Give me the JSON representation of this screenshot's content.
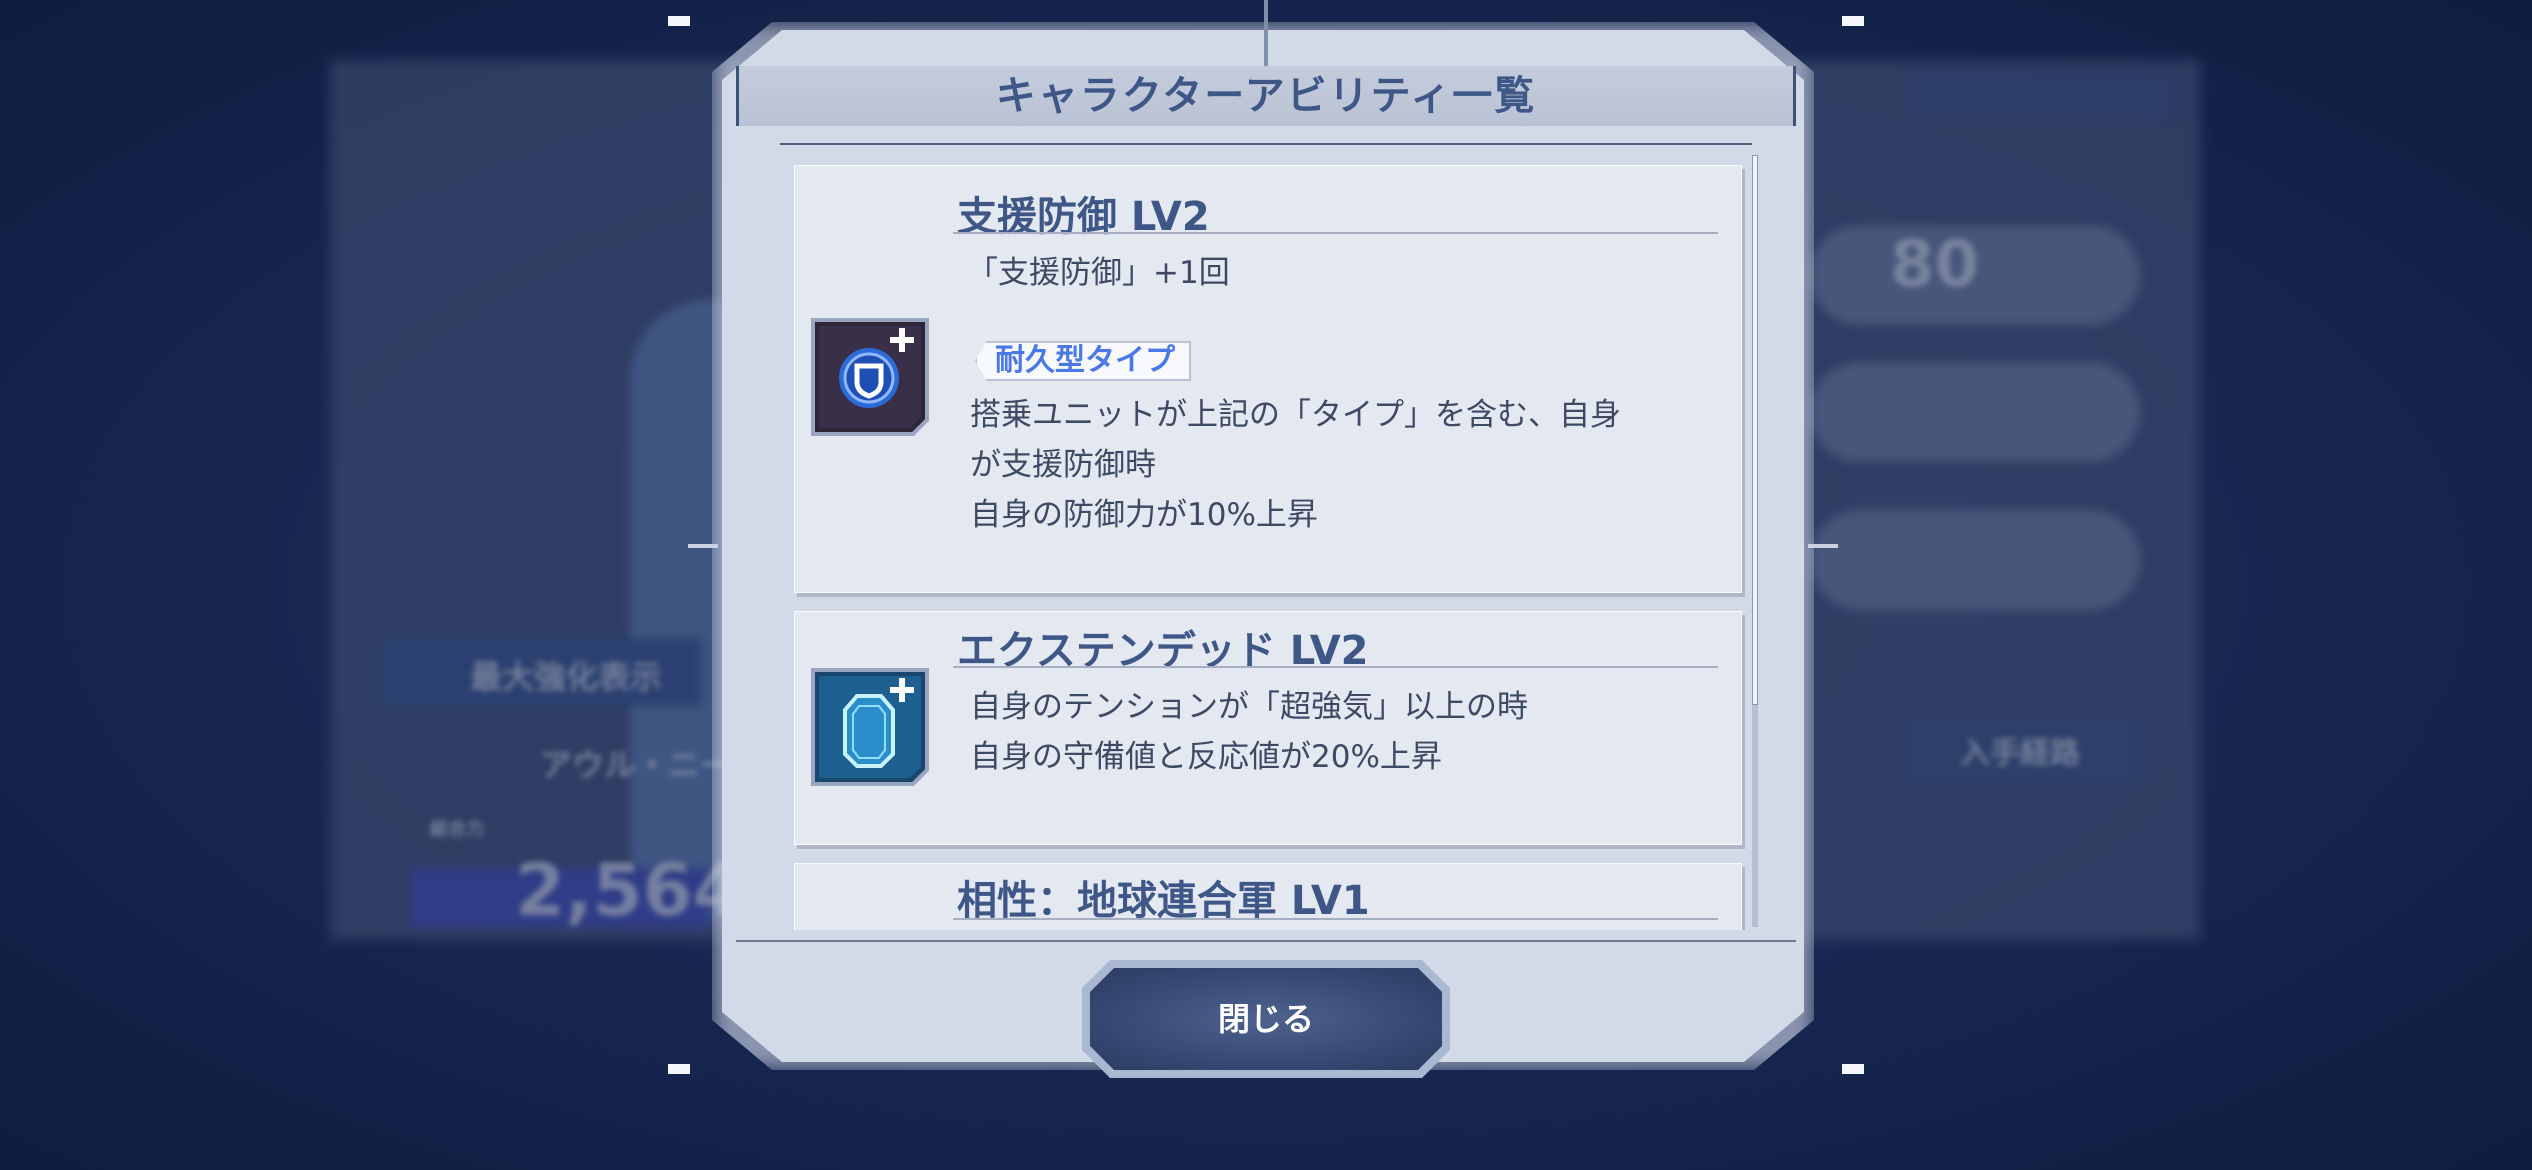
{
  "modal": {
    "title": "キャラクターアビリティ一覧",
    "close_label": "閉じる"
  },
  "abilities": [
    {
      "title": "支援防御 LV2",
      "line1": "「支援防御」+1回",
      "type_tag": "耐久型タイプ",
      "desc": [
        "搭乗ユニットが上記の「タイプ」を含む、自身",
        "が支援防御時",
        "自身の防御力が10%上昇"
      ],
      "icon": "shield-plus-icon"
    },
    {
      "title": "エクステンデッド LV2",
      "desc": [
        "自身のテンションが「超強気」以上の時",
        "自身の守備値と反応値が20%上昇"
      ],
      "icon": "capsule-plus-icon"
    },
    {
      "title": "相性：地球連合軍 LV1"
    }
  ],
  "background": {
    "checkbox_label": "最大強化表示",
    "power_value": "2,564",
    "level_value": "80",
    "acquire_button": "入手経路",
    "unit_name": "アウル・ニー",
    "small_badge": "総合力"
  },
  "colors": {
    "accent": "#3e5787",
    "tag": "#4a78e6",
    "panel": "#d3dae7"
  }
}
